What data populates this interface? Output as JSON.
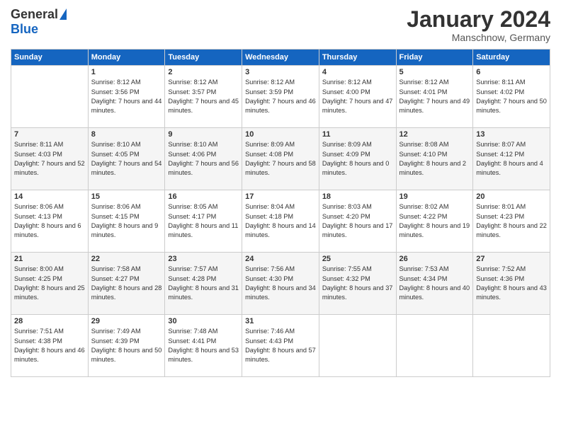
{
  "header": {
    "logo_general": "General",
    "logo_blue": "Blue",
    "month_title": "January 2024",
    "location": "Manschnow, Germany"
  },
  "days_of_week": [
    "Sunday",
    "Monday",
    "Tuesday",
    "Wednesday",
    "Thursday",
    "Friday",
    "Saturday"
  ],
  "weeks": [
    [
      {
        "day": "",
        "sunrise": "",
        "sunset": "",
        "daylight": ""
      },
      {
        "day": "1",
        "sunrise": "Sunrise: 8:12 AM",
        "sunset": "Sunset: 3:56 PM",
        "daylight": "Daylight: 7 hours and 44 minutes."
      },
      {
        "day": "2",
        "sunrise": "Sunrise: 8:12 AM",
        "sunset": "Sunset: 3:57 PM",
        "daylight": "Daylight: 7 hours and 45 minutes."
      },
      {
        "day": "3",
        "sunrise": "Sunrise: 8:12 AM",
        "sunset": "Sunset: 3:59 PM",
        "daylight": "Daylight: 7 hours and 46 minutes."
      },
      {
        "day": "4",
        "sunrise": "Sunrise: 8:12 AM",
        "sunset": "Sunset: 4:00 PM",
        "daylight": "Daylight: 7 hours and 47 minutes."
      },
      {
        "day": "5",
        "sunrise": "Sunrise: 8:12 AM",
        "sunset": "Sunset: 4:01 PM",
        "daylight": "Daylight: 7 hours and 49 minutes."
      },
      {
        "day": "6",
        "sunrise": "Sunrise: 8:11 AM",
        "sunset": "Sunset: 4:02 PM",
        "daylight": "Daylight: 7 hours and 50 minutes."
      }
    ],
    [
      {
        "day": "7",
        "sunrise": "Sunrise: 8:11 AM",
        "sunset": "Sunset: 4:03 PM",
        "daylight": "Daylight: 7 hours and 52 minutes."
      },
      {
        "day": "8",
        "sunrise": "Sunrise: 8:10 AM",
        "sunset": "Sunset: 4:05 PM",
        "daylight": "Daylight: 7 hours and 54 minutes."
      },
      {
        "day": "9",
        "sunrise": "Sunrise: 8:10 AM",
        "sunset": "Sunset: 4:06 PM",
        "daylight": "Daylight: 7 hours and 56 minutes."
      },
      {
        "day": "10",
        "sunrise": "Sunrise: 8:09 AM",
        "sunset": "Sunset: 4:08 PM",
        "daylight": "Daylight: 7 hours and 58 minutes."
      },
      {
        "day": "11",
        "sunrise": "Sunrise: 8:09 AM",
        "sunset": "Sunset: 4:09 PM",
        "daylight": "Daylight: 8 hours and 0 minutes."
      },
      {
        "day": "12",
        "sunrise": "Sunrise: 8:08 AM",
        "sunset": "Sunset: 4:10 PM",
        "daylight": "Daylight: 8 hours and 2 minutes."
      },
      {
        "day": "13",
        "sunrise": "Sunrise: 8:07 AM",
        "sunset": "Sunset: 4:12 PM",
        "daylight": "Daylight: 8 hours and 4 minutes."
      }
    ],
    [
      {
        "day": "14",
        "sunrise": "Sunrise: 8:06 AM",
        "sunset": "Sunset: 4:13 PM",
        "daylight": "Daylight: 8 hours and 6 minutes."
      },
      {
        "day": "15",
        "sunrise": "Sunrise: 8:06 AM",
        "sunset": "Sunset: 4:15 PM",
        "daylight": "Daylight: 8 hours and 9 minutes."
      },
      {
        "day": "16",
        "sunrise": "Sunrise: 8:05 AM",
        "sunset": "Sunset: 4:17 PM",
        "daylight": "Daylight: 8 hours and 11 minutes."
      },
      {
        "day": "17",
        "sunrise": "Sunrise: 8:04 AM",
        "sunset": "Sunset: 4:18 PM",
        "daylight": "Daylight: 8 hours and 14 minutes."
      },
      {
        "day": "18",
        "sunrise": "Sunrise: 8:03 AM",
        "sunset": "Sunset: 4:20 PM",
        "daylight": "Daylight: 8 hours and 17 minutes."
      },
      {
        "day": "19",
        "sunrise": "Sunrise: 8:02 AM",
        "sunset": "Sunset: 4:22 PM",
        "daylight": "Daylight: 8 hours and 19 minutes."
      },
      {
        "day": "20",
        "sunrise": "Sunrise: 8:01 AM",
        "sunset": "Sunset: 4:23 PM",
        "daylight": "Daylight: 8 hours and 22 minutes."
      }
    ],
    [
      {
        "day": "21",
        "sunrise": "Sunrise: 8:00 AM",
        "sunset": "Sunset: 4:25 PM",
        "daylight": "Daylight: 8 hours and 25 minutes."
      },
      {
        "day": "22",
        "sunrise": "Sunrise: 7:58 AM",
        "sunset": "Sunset: 4:27 PM",
        "daylight": "Daylight: 8 hours and 28 minutes."
      },
      {
        "day": "23",
        "sunrise": "Sunrise: 7:57 AM",
        "sunset": "Sunset: 4:28 PM",
        "daylight": "Daylight: 8 hours and 31 minutes."
      },
      {
        "day": "24",
        "sunrise": "Sunrise: 7:56 AM",
        "sunset": "Sunset: 4:30 PM",
        "daylight": "Daylight: 8 hours and 34 minutes."
      },
      {
        "day": "25",
        "sunrise": "Sunrise: 7:55 AM",
        "sunset": "Sunset: 4:32 PM",
        "daylight": "Daylight: 8 hours and 37 minutes."
      },
      {
        "day": "26",
        "sunrise": "Sunrise: 7:53 AM",
        "sunset": "Sunset: 4:34 PM",
        "daylight": "Daylight: 8 hours and 40 minutes."
      },
      {
        "day": "27",
        "sunrise": "Sunrise: 7:52 AM",
        "sunset": "Sunset: 4:36 PM",
        "daylight": "Daylight: 8 hours and 43 minutes."
      }
    ],
    [
      {
        "day": "28",
        "sunrise": "Sunrise: 7:51 AM",
        "sunset": "Sunset: 4:38 PM",
        "daylight": "Daylight: 8 hours and 46 minutes."
      },
      {
        "day": "29",
        "sunrise": "Sunrise: 7:49 AM",
        "sunset": "Sunset: 4:39 PM",
        "daylight": "Daylight: 8 hours and 50 minutes."
      },
      {
        "day": "30",
        "sunrise": "Sunrise: 7:48 AM",
        "sunset": "Sunset: 4:41 PM",
        "daylight": "Daylight: 8 hours and 53 minutes."
      },
      {
        "day": "31",
        "sunrise": "Sunrise: 7:46 AM",
        "sunset": "Sunset: 4:43 PM",
        "daylight": "Daylight: 8 hours and 57 minutes."
      },
      {
        "day": "",
        "sunrise": "",
        "sunset": "",
        "daylight": ""
      },
      {
        "day": "",
        "sunrise": "",
        "sunset": "",
        "daylight": ""
      },
      {
        "day": "",
        "sunrise": "",
        "sunset": "",
        "daylight": ""
      }
    ]
  ]
}
